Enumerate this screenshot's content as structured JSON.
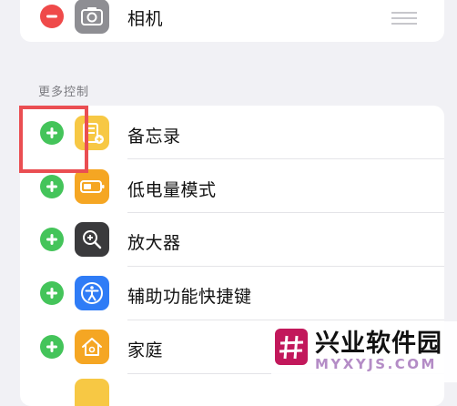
{
  "included": {
    "items": [
      {
        "label": "相机",
        "icon": "camera-icon",
        "action": "remove",
        "icon_color": "#8e8e93"
      }
    ]
  },
  "more_controls": {
    "header": "更多控制",
    "items": [
      {
        "label": "备忘录",
        "icon": "notes-icon",
        "icon_color": "#f7c844"
      },
      {
        "label": "低电量模式",
        "icon": "low-power-battery-icon",
        "icon_color": "#f5a623"
      },
      {
        "label": "放大器",
        "icon": "magnifier-icon",
        "icon_color": "#3a3a3c"
      },
      {
        "label": "辅助功能快捷键",
        "icon": "accessibility-icon",
        "icon_color": "#2f7cf6"
      },
      {
        "label": "家庭",
        "icon": "home-icon",
        "icon_color": "#f5a623"
      }
    ]
  },
  "colors": {
    "add": "#44c45a",
    "remove": "#ef4a4a",
    "highlight": "#ea4e52"
  },
  "watermark": {
    "name": "兴业软件园",
    "url": "MYXYJS.COM"
  }
}
